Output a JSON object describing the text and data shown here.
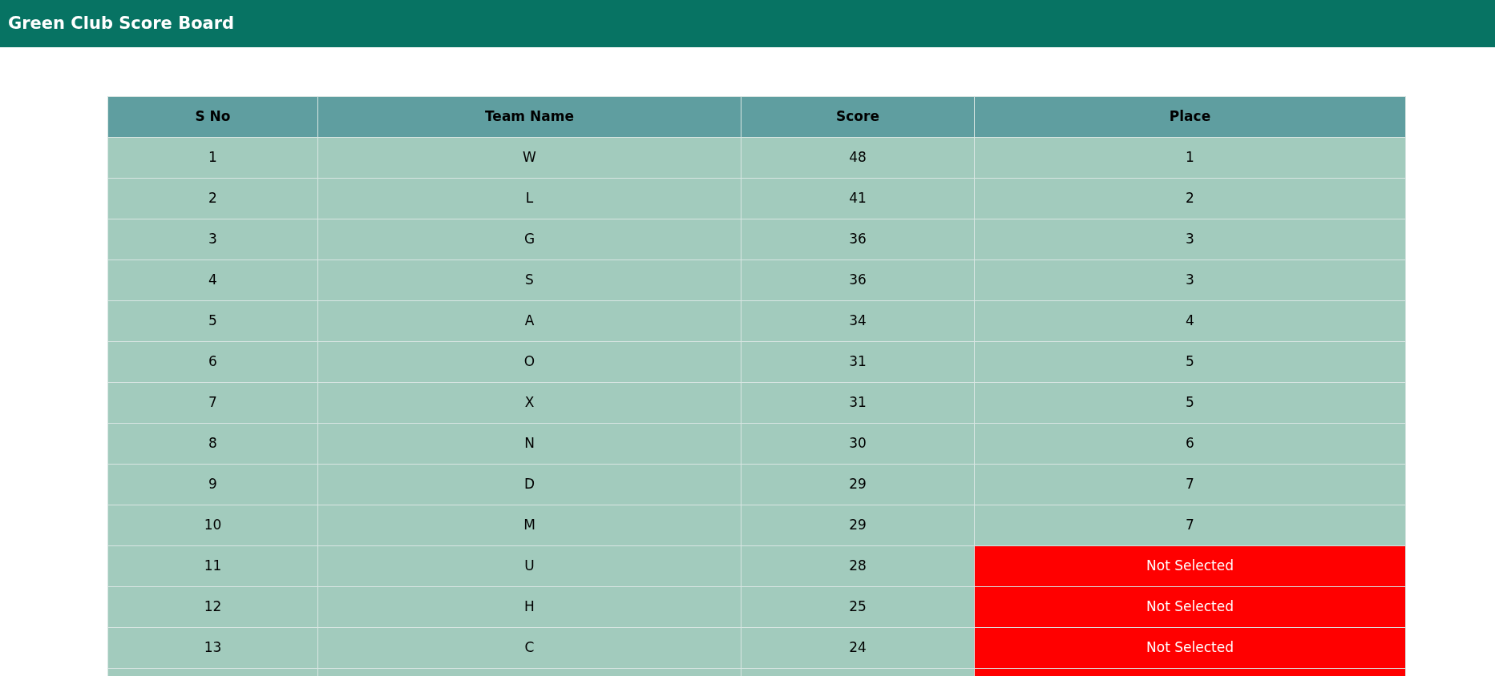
{
  "header": {
    "title": "Green Club Score Board"
  },
  "table": {
    "columns": [
      "S No",
      "Team Name",
      "Score",
      "Place"
    ],
    "rows": [
      {
        "sno": "1",
        "team": "W",
        "score": "48",
        "place": "1",
        "qualified": true
      },
      {
        "sno": "2",
        "team": "L",
        "score": "41",
        "place": "2",
        "qualified": true
      },
      {
        "sno": "3",
        "team": "G",
        "score": "36",
        "place": "3",
        "qualified": true
      },
      {
        "sno": "4",
        "team": "S",
        "score": "36",
        "place": "3",
        "qualified": true
      },
      {
        "sno": "5",
        "team": "A",
        "score": "34",
        "place": "4",
        "qualified": true
      },
      {
        "sno": "6",
        "team": "O",
        "score": "31",
        "place": "5",
        "qualified": true
      },
      {
        "sno": "7",
        "team": "X",
        "score": "31",
        "place": "5",
        "qualified": true
      },
      {
        "sno": "8",
        "team": "N",
        "score": "30",
        "place": "6",
        "qualified": true
      },
      {
        "sno": "9",
        "team": "D",
        "score": "29",
        "place": "7",
        "qualified": true
      },
      {
        "sno": "10",
        "team": "M",
        "score": "29",
        "place": "7",
        "qualified": true
      },
      {
        "sno": "11",
        "team": "U",
        "score": "28",
        "place": "Not Selected",
        "qualified": false
      },
      {
        "sno": "12",
        "team": "H",
        "score": "25",
        "place": "Not Selected",
        "qualified": false
      },
      {
        "sno": "13",
        "team": "C",
        "score": "24",
        "place": "Not Selected",
        "qualified": false
      },
      {
        "qualified": false
      }
    ]
  }
}
